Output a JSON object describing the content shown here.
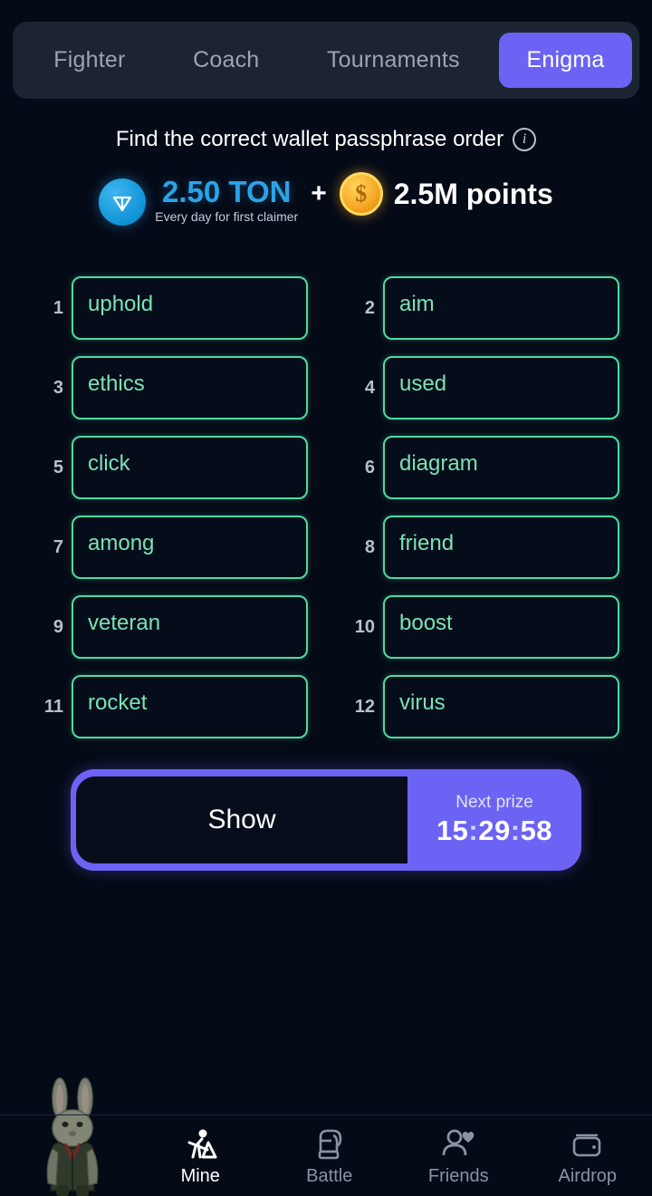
{
  "tabs": [
    {
      "label": "Fighter",
      "active": false
    },
    {
      "label": "Coach",
      "active": false
    },
    {
      "label": "Tournaments",
      "active": false
    },
    {
      "label": "Enigma",
      "active": true
    }
  ],
  "header": {
    "title": "Find the correct wallet passphrase order",
    "info_icon": "info-icon",
    "info_glyph": "i"
  },
  "prize": {
    "ton_icon": "ton-coin-icon",
    "ton_amount": "2.50 TON",
    "ton_subtitle": "Every day for first claimer",
    "plus": "+",
    "points_icon": "points-coin-icon",
    "points_glyph": "$",
    "points_amount": "2.5M points",
    "ton_color": "#2aa3e8",
    "points_color": "#f6a623"
  },
  "words": [
    {
      "num": "1",
      "word": "uphold"
    },
    {
      "num": "2",
      "word": "aim"
    },
    {
      "num": "3",
      "word": "ethics"
    },
    {
      "num": "4",
      "word": "used"
    },
    {
      "num": "5",
      "word": "click"
    },
    {
      "num": "6",
      "word": "diagram"
    },
    {
      "num": "7",
      "word": "among"
    },
    {
      "num": "8",
      "word": "friend"
    },
    {
      "num": "9",
      "word": "veteran"
    },
    {
      "num": "10",
      "word": "boost"
    },
    {
      "num": "11",
      "word": "rocket"
    },
    {
      "num": "12",
      "word": "virus"
    }
  ],
  "action": {
    "show_label": "Show",
    "timer_label": "Next prize",
    "timer_hours": "15",
    "timer_sep1": ":",
    "timer_minutes": "29",
    "timer_sep2": ":",
    "timer_seconds": "58",
    "accent_color": "#6c63f5"
  },
  "bottom_nav": [
    {
      "label": "Mine",
      "icon": "mine-icon",
      "active": true
    },
    {
      "label": "Battle",
      "icon": "battle-icon",
      "active": false
    },
    {
      "label": "Friends",
      "icon": "friends-icon",
      "active": false
    },
    {
      "label": "Airdrop",
      "icon": "airdrop-icon",
      "active": false
    }
  ],
  "character": {
    "name": "rabbit-avatar"
  }
}
